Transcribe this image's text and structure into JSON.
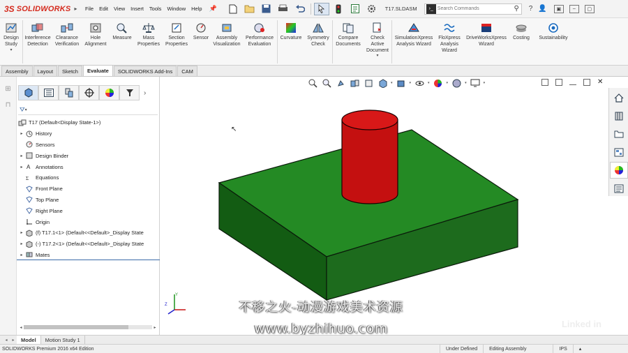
{
  "app": {
    "logo_mark": "3S",
    "logo_text": "SOLIDWORKS",
    "file_name": "T17.SLDASM",
    "menu": [
      "File",
      "Edit",
      "View",
      "Insert",
      "Tools",
      "Window",
      "Help"
    ],
    "search": {
      "placeholder": "Search Commands"
    }
  },
  "ribbon": {
    "design_study": "Design Study",
    "items": [
      {
        "label": "Interference Detection",
        "icon": "interference-icon"
      },
      {
        "label": "Clearance Verification",
        "icon": "clearance-icon"
      },
      {
        "label": "Hole Alignment",
        "icon": "hole-alignment-icon"
      },
      {
        "label": "Measure",
        "icon": "measure-icon"
      },
      {
        "label": "Mass Properties",
        "icon": "mass-properties-icon"
      },
      {
        "label": "Section Properties",
        "icon": "section-properties-icon"
      },
      {
        "label": "Sensor",
        "icon": "sensor-icon"
      },
      {
        "label": "Assembly Visualization",
        "icon": "assembly-visualization-icon"
      },
      {
        "label": "Performance Evaluation",
        "icon": "performance-evaluation-icon"
      },
      {
        "label": "Curvature",
        "icon": "curvature-icon"
      },
      {
        "label": "Symmetry Check",
        "icon": "symmetry-check-icon"
      },
      {
        "label": "Compare Documents",
        "icon": "compare-documents-icon"
      },
      {
        "label": "Check Active Document",
        "icon": "check-document-icon"
      },
      {
        "label": "SimulationXpress Analysis Wizard",
        "icon": "simulationxpress-icon"
      },
      {
        "label": "FloXpress Analysis Wizard",
        "icon": "floxpress-icon"
      },
      {
        "label": "DriveWorksXpress Wizard",
        "icon": "driveworksxpress-icon"
      },
      {
        "label": "Costing",
        "icon": "costing-icon"
      },
      {
        "label": "Sustainability",
        "icon": "sustainability-icon"
      }
    ]
  },
  "tabs": [
    "Assembly",
    "Layout",
    "Sketch",
    "Evaluate",
    "SOLIDWORKS Add-Ins",
    "CAM"
  ],
  "active_tab": "Evaluate",
  "tree": {
    "root": "T17  (Default<Display State-1>)",
    "items": [
      {
        "label": "History",
        "expander": "▸",
        "icon": "history-icon"
      },
      {
        "label": "Sensors",
        "expander": "",
        "icon": "sensors-icon"
      },
      {
        "label": "Design Binder",
        "expander": "▸",
        "icon": "design-binder-icon"
      },
      {
        "label": "Annotations",
        "expander": "▸",
        "icon": "annotations-icon"
      },
      {
        "label": "Equations",
        "expander": "",
        "icon": "equations-icon"
      },
      {
        "label": "Front Plane",
        "expander": "",
        "icon": "plane-icon"
      },
      {
        "label": "Top Plane",
        "expander": "",
        "icon": "plane-icon"
      },
      {
        "label": "Right Plane",
        "expander": "",
        "icon": "plane-icon"
      },
      {
        "label": "Origin",
        "expander": "",
        "icon": "origin-icon"
      },
      {
        "label": "(f) T17.1<1> (Default<<Default>_Display State",
        "expander": "▸",
        "icon": "component-icon"
      },
      {
        "label": "(-) T17.2<1> (Default<<Default>_Display State",
        "expander": "▸",
        "icon": "component-icon"
      },
      {
        "label": "Mates",
        "expander": "▸",
        "icon": "mates-icon"
      }
    ]
  },
  "watermark": {
    "line1": "不移之火-动漫游戏美术资源",
    "line2": "www.byzhihuo.com",
    "brand": "Linked in"
  },
  "bottom_tabs": [
    "Model",
    "Motion Study 1"
  ],
  "status": {
    "edition": "SOLIDWORKS Premium 2016 x64 Edition",
    "state": "Under Defined",
    "mode": "Editing Assembly",
    "units": "IPS"
  },
  "colors": {
    "box_front": "#1d6b1d",
    "box_top": "#248a24",
    "box_side": "#135413",
    "cylinder": "#cc1111",
    "accent": "#d52b1e"
  }
}
